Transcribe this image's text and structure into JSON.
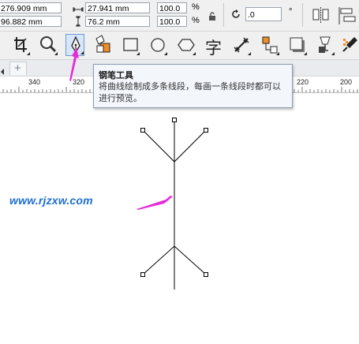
{
  "property_bar": {
    "x_position": "276.909 mm",
    "y_position": "96.882 mm",
    "width": "27.941 mm",
    "height": "76.2 mm",
    "scale_w": "100.0",
    "scale_h": "100.0",
    "percent_symbol": "%",
    "rotation": ".0",
    "degree_symbol": "°"
  },
  "toolbox": {
    "text_tool_glyph": "字",
    "selected_tool": "pen-tool"
  },
  "tabs": {
    "add_glyph": "+"
  },
  "ruler": {
    "labels": [
      "340",
      "320",
      "220",
      "200"
    ]
  },
  "tooltip": {
    "title": "钢笔工具",
    "description": "将曲线绘制成多条线段，每画一条线段时都可以进行预览。"
  },
  "watermark": {
    "text": "www.rjzxw.com"
  },
  "colors": {
    "annotation_arrow": "#e62bd8",
    "watermark": "#1f6fd1",
    "toolbar_bg": "#f0f0f0"
  }
}
